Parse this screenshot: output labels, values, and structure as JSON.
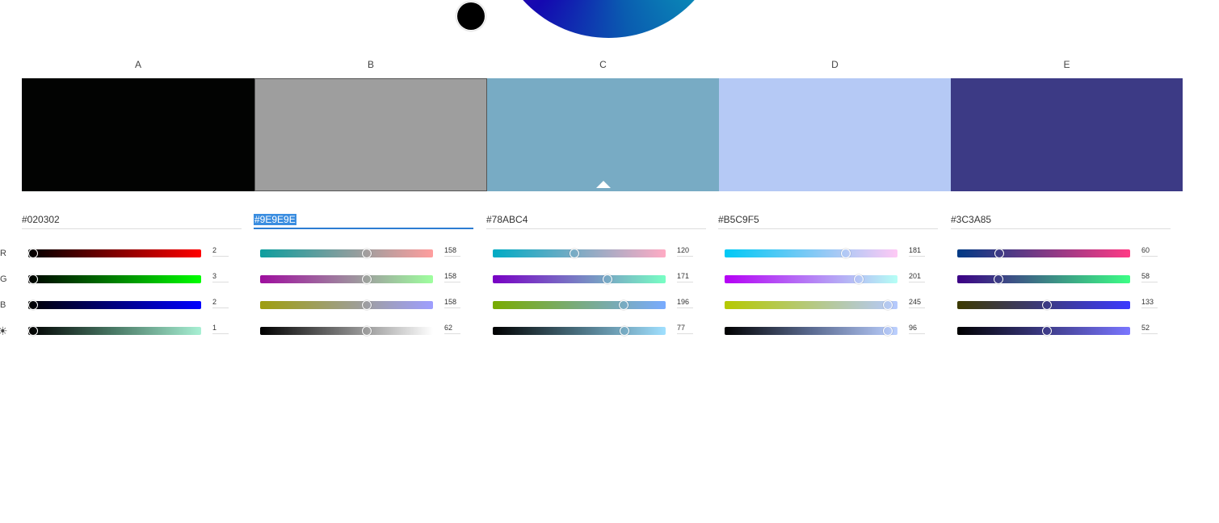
{
  "columns": [
    {
      "label": "A",
      "hex": "#020302",
      "color": "#020302",
      "r": 2,
      "g": 3,
      "b": 2,
      "brightness": 1,
      "grads": [
        "linear-gradient(90deg,#000000,#ff0000)",
        "linear-gradient(90deg,#000000,#00ff00)",
        "linear-gradient(90deg,#000000,#0000ff)",
        "linear-gradient(90deg,#000000,#4a7a66,#a8f0d4)"
      ]
    },
    {
      "label": "B",
      "hex": "#9E9E9E",
      "color": "#9E9E9E",
      "r": 158,
      "g": 158,
      "b": 158,
      "brightness": 62,
      "grads": [
        "linear-gradient(90deg,#0e9e9e,#ff9e9e)",
        "linear-gradient(90deg,#9e0e9e,#9eff9e)",
        "linear-gradient(90deg,#9e9e0e,#9e9eff)",
        "linear-gradient(90deg,#000000,#ffffff)"
      ]
    },
    {
      "label": "C",
      "hex": "#78ABC4",
      "color": "#78ABC4",
      "r": 120,
      "g": 171,
      "b": 196,
      "brightness": 77,
      "grads": [
        "linear-gradient(90deg,#00abc4,#ffabc4)",
        "linear-gradient(90deg,#7800c4,#78ffc4)",
        "linear-gradient(90deg,#78ab00,#78abff)",
        "linear-gradient(90deg,#000000,#4a7080,#a0e0ff)"
      ]
    },
    {
      "label": "D",
      "hex": "#B5C9F5",
      "color": "#B5C9F5",
      "r": 181,
      "g": 201,
      "b": 245,
      "brightness": 96,
      "grads": [
        "linear-gradient(90deg,#00c9f5,#ffc9f5)",
        "linear-gradient(90deg,#b500f5,#b5fff5)",
        "linear-gradient(90deg,#b5c900,#b5c9ff)",
        "linear-gradient(90deg,#000000,#5a6a90,#bcd0ff)"
      ]
    },
    {
      "label": "E",
      "hex": "#3C3A85",
      "color": "#3C3A85",
      "r": 60,
      "g": 58,
      "b": 133,
      "brightness": 52,
      "grads": [
        "linear-gradient(90deg,#003a85,#ff3a85)",
        "linear-gradient(90deg,#3c0085,#3cff85)",
        "linear-gradient(90deg,#3c3a00,#3c3aff)",
        "linear-gradient(90deg,#000000,#3c3a85,#7a76ff)"
      ]
    }
  ],
  "channel_labels": [
    "R",
    "G",
    "B"
  ],
  "brightness_icon": "sun-icon",
  "base_color": "#020302",
  "active_column": 1,
  "selected_swatch": 2
}
